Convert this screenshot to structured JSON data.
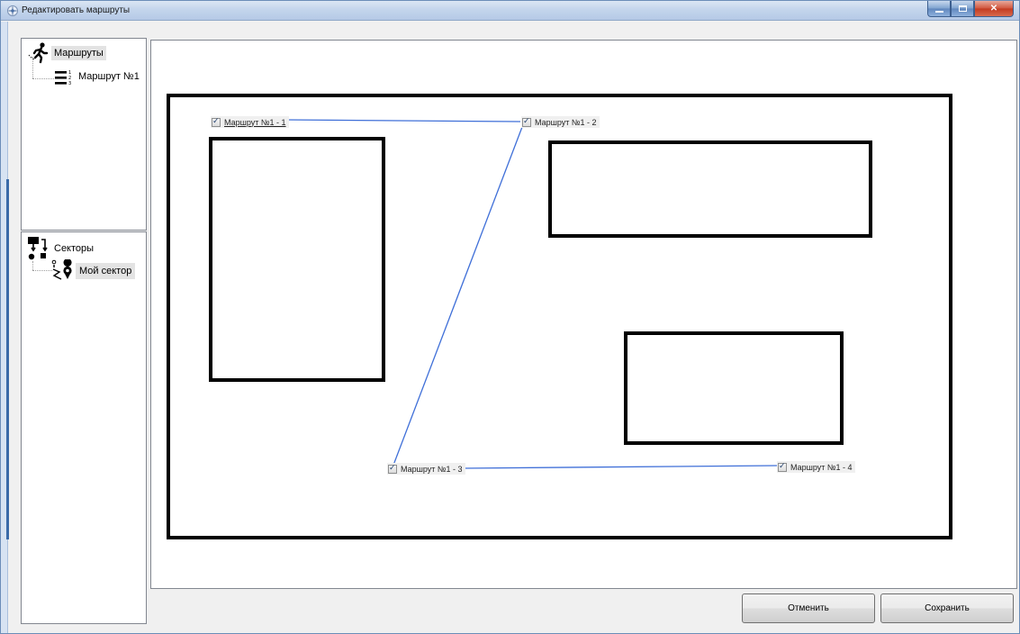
{
  "window": {
    "title": "Редактировать маршруты",
    "icons": {
      "app": "route-app-icon",
      "minimize": "minimize-icon",
      "maximize": "maximize-icon",
      "close": "close-icon"
    }
  },
  "routes_tree": {
    "root_label": "Маршруты",
    "root_icon": "walking-person-icon",
    "items": [
      {
        "label": "Маршрут №1",
        "icon": "numbered-list-icon"
      }
    ]
  },
  "sectors_tree": {
    "root_label": "Секторы",
    "root_icon": "hierarchy-icon",
    "items": [
      {
        "label": "Мой сектор",
        "icon": "map-pin-path-icon",
        "selected": true
      }
    ]
  },
  "canvas": {
    "route_points": [
      {
        "label": "Маршрут №1 - 1",
        "checked": true,
        "active": true
      },
      {
        "label": "Маршрут №1 - 2",
        "checked": true,
        "active": false
      },
      {
        "label": "Маршрут №1 - 3",
        "checked": true,
        "active": false
      },
      {
        "label": "Маршрут №1 - 4",
        "checked": true,
        "active": false
      }
    ],
    "colors": {
      "route_line": "#3f6fd8",
      "walls": "#000000",
      "background": "#ffffff"
    }
  },
  "buttons": {
    "cancel": "Отменить",
    "save": "Сохранить"
  }
}
